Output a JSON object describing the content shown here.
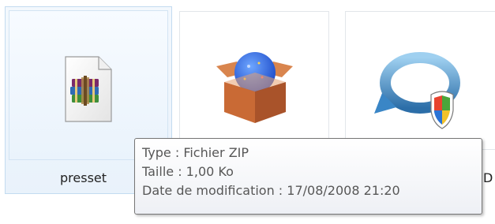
{
  "files": [
    {
      "name": "presset",
      "icon": "winrar-archive-icon",
      "selected": true
    },
    {
      "name": "",
      "icon": "software-package-box-icon",
      "selected": false
    },
    {
      "name": "D",
      "icon": "system-restore-shield-icon",
      "selected": false
    }
  ],
  "tooltip": {
    "type_line": "Type : Fichier ZIP",
    "size_line": "Taille : 1,00 Ko",
    "date_line": "Date de modification : 17/08/2008 21:20"
  },
  "colors": {
    "selection_fill": "#eaf3fc",
    "selection_border": "#c3dbf0",
    "tooltip_border": "#767676",
    "tooltip_text": "#575757"
  }
}
